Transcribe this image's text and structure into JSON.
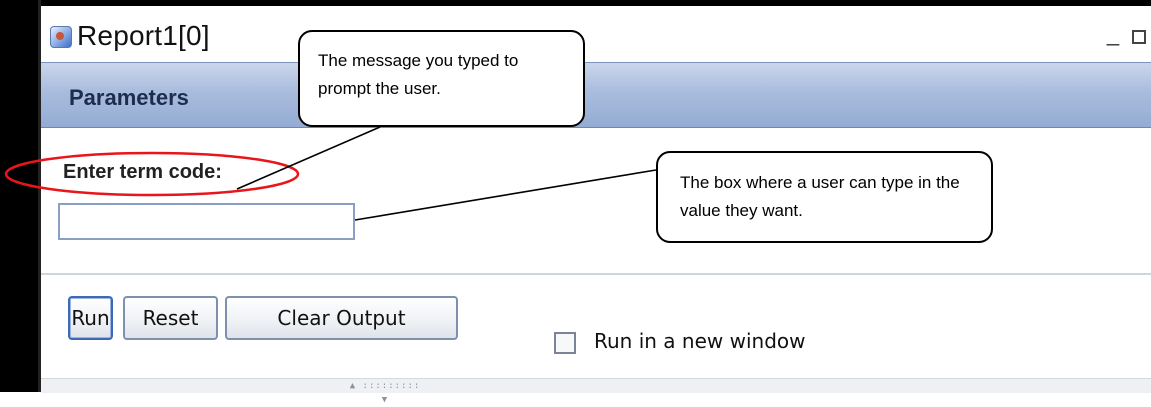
{
  "window": {
    "title": "Report1[0]",
    "minimize_glyph": "_"
  },
  "panel": {
    "header": "Parameters"
  },
  "form": {
    "prompt_label": "Enter term code:",
    "input_value": "",
    "run_button": "Run",
    "reset_button": "Reset",
    "clear_output_button": "Clear Output",
    "new_window_checked": false,
    "new_window_label": "Run in a new window",
    "resize_handle": "▲ ::::::::: ▼"
  },
  "annotations": {
    "prompt_callout": "The message you typed to prompt the user.",
    "input_callout": "The box where a user can type in the value they want.",
    "line_color": "#000000",
    "highlight_color": "#e8151b"
  },
  "icons": {
    "app": "report-app-icon",
    "maximize": "maximize-icon"
  }
}
